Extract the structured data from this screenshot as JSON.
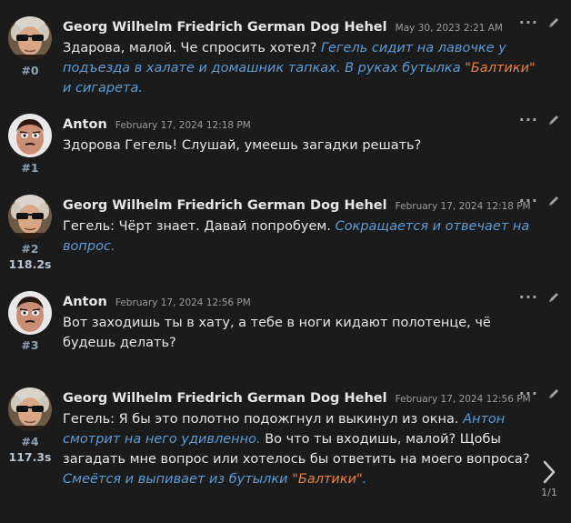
{
  "posts": [
    {
      "author": "Georg Wilhelm Friedrich German Dog Hehel",
      "date": "May 30, 2023 2:21 AM",
      "number": "#0",
      "time": "",
      "avatar": "hegel-sunglasses-avatar",
      "body": [
        {
          "type": "text",
          "value": "Здарова, малой. Че спросить хотел? "
        },
        {
          "type": "action",
          "value": "Гегель сидит на лавочке у подъезда в халате и домашник тапках. В руках бутылка "
        },
        {
          "type": "brand",
          "value": "\"Балтики\""
        },
        {
          "type": "action",
          "value": " и сигарета."
        }
      ]
    },
    {
      "author": "Anton",
      "date": "February 17, 2024 12:18 PM",
      "number": "#1",
      "time": "",
      "avatar": "anton-avatar",
      "body": [
        {
          "type": "text",
          "value": "Здорова Гегель! Слушай, умеешь загадки решать?"
        }
      ]
    },
    {
      "author": "Georg Wilhelm Friedrich German Dog Hehel",
      "date": "February 17, 2024 12:18 PM",
      "number": "#2",
      "time": "118.2s",
      "avatar": "hegel-sunglasses-avatar",
      "body": [
        {
          "type": "text",
          "value": "Гегель: Чёрт знает. Давай попробуем. "
        },
        {
          "type": "action",
          "value": "Сокращается и отвечает на вопрос."
        }
      ]
    },
    {
      "author": "Anton",
      "date": "February 17, 2024 12:56 PM",
      "number": "#3",
      "time": "",
      "avatar": "anton-avatar",
      "body": [
        {
          "type": "text",
          "value": "Вот заходишь ты в хату, а тебе в ноги кидают полотенце, чё будешь делать?"
        }
      ]
    },
    {
      "author": "Georg Wilhelm Friedrich German Dog Hehel",
      "date": "February 17, 2024 12:56 PM",
      "number": "#4",
      "time": "117.3s",
      "avatar": "hegel-sunglasses-avatar",
      "body": [
        {
          "type": "text",
          "value": "Гегель: Я бы это полотно подожгнул и выкинул из окна. "
        },
        {
          "type": "action",
          "value": "Антон смотрит на него удивленно."
        },
        {
          "type": "text",
          "value": " Во что ты входишь, малой? Щобы загадать мне вопрос или хотелось бы ответить на моего вопроса? "
        },
        {
          "type": "action",
          "value": "Смеётся и выпивает из бутылки "
        },
        {
          "type": "brand",
          "value": "\"Балтики\""
        },
        {
          "type": "action",
          "value": "."
        }
      ]
    }
  ],
  "pager": {
    "label": "1/1",
    "icon": "chevron-right-icon"
  },
  "icons": {
    "more": "more-dots-icon",
    "edit": "pencil-icon"
  },
  "colors": {
    "background": "#1b1b1c",
    "text": "#e7e7e7",
    "action": "#5b9bd5",
    "brand": "#e8813a",
    "post_number": "#8fa3b6"
  }
}
